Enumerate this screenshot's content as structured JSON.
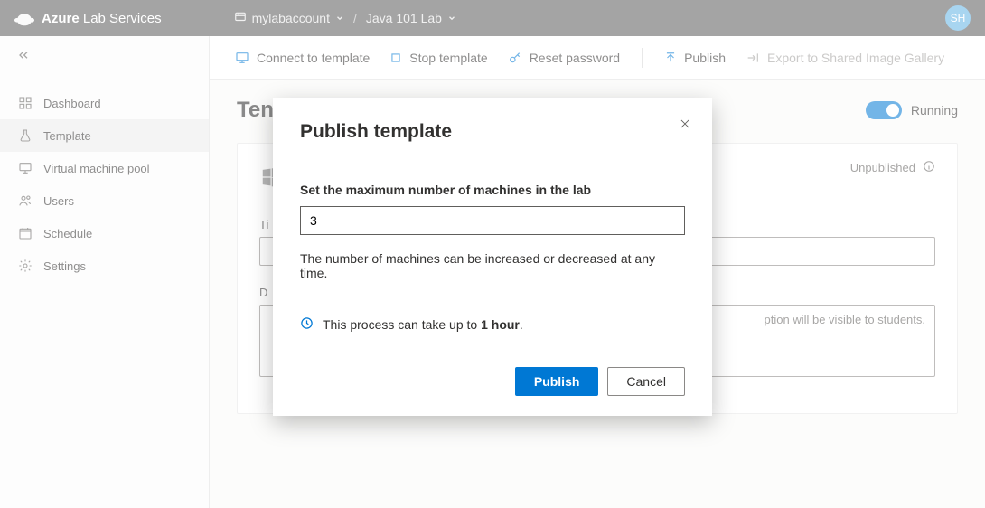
{
  "header": {
    "brand_bold": "Azure",
    "brand_rest": " Lab Services",
    "breadcrumb": {
      "account": "mylabaccount",
      "lab": "Java 101 Lab"
    },
    "avatar_initials": "SH"
  },
  "sidebar": {
    "items": [
      {
        "icon": "dashboard-icon",
        "label": "Dashboard"
      },
      {
        "icon": "flask-icon",
        "label": "Template"
      },
      {
        "icon": "monitor-icon",
        "label": "Virtual machine pool"
      },
      {
        "icon": "users-icon",
        "label": "Users"
      },
      {
        "icon": "calendar-icon",
        "label": "Schedule"
      },
      {
        "icon": "gear-icon",
        "label": "Settings"
      }
    ],
    "active_index": 1
  },
  "toolbar": {
    "connect": "Connect to template",
    "stop": "Stop template",
    "reset": "Reset password",
    "publish": "Publish",
    "export": "Export to Shared Image Gallery"
  },
  "page": {
    "title_visible": "Ten",
    "running_label": "Running",
    "status_text": "Unpublished",
    "title_field_label": "Ti",
    "desc_field_label": "D",
    "desc_placeholder_tail": "ption will be visible to students."
  },
  "modal": {
    "title": "Publish template",
    "field_label": "Set the maximum number of machines in the lab",
    "field_value": "3",
    "hint": "The number of machines can be increased or decreased at any time.",
    "note_prefix": "This process can take up to ",
    "note_bold": "1 hour",
    "note_suffix": ".",
    "publish": "Publish",
    "cancel": "Cancel"
  }
}
